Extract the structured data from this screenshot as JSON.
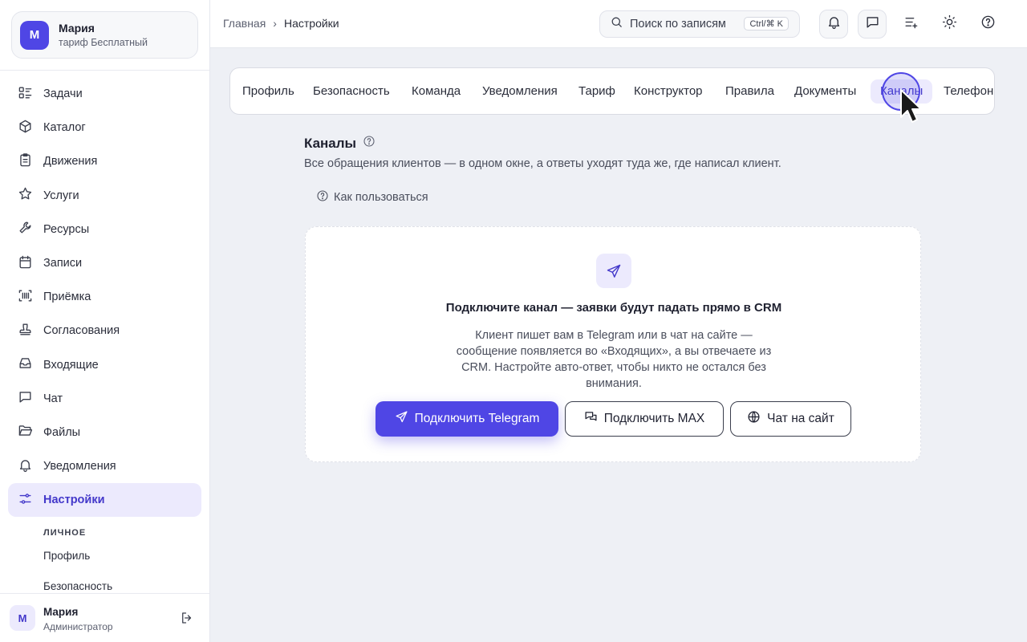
{
  "account": {
    "avatar_letter": "М",
    "name": "Мария",
    "plan": "тариф Бесплатный"
  },
  "sidebar": {
    "items": [
      {
        "label": "Задачи",
        "icon": "tasks-icon"
      },
      {
        "label": "Каталог",
        "icon": "box-icon"
      },
      {
        "label": "Движения",
        "icon": "clipboard-icon"
      },
      {
        "label": "Услуги",
        "icon": "star-icon"
      },
      {
        "label": "Ресурсы",
        "icon": "wrench-icon"
      },
      {
        "label": "Записи",
        "icon": "calendar-icon"
      },
      {
        "label": "Приёмка",
        "icon": "barcode-icon"
      },
      {
        "label": "Согласования",
        "icon": "stamp-icon"
      },
      {
        "label": "Входящие",
        "icon": "inbox-icon"
      },
      {
        "label": "Чат",
        "icon": "chat-icon"
      },
      {
        "label": "Файлы",
        "icon": "folder-icon"
      },
      {
        "label": "Уведомления",
        "icon": "bell-icon"
      },
      {
        "label": "Настройки",
        "icon": "sliders-icon",
        "active": true
      }
    ],
    "sub_heading": "ЛИЧНОЕ",
    "sub_items": [
      "Профиль",
      "Безопасность"
    ]
  },
  "footer": {
    "avatar_letter": "М",
    "name": "Мария",
    "role": "Администратор"
  },
  "topbar": {
    "breadcrumb_home": "Главная",
    "breadcrumb_sep": "›",
    "breadcrumb_current": "Настройки",
    "search_placeholder": "Поиск по записям",
    "search_shortcut": "Ctrl/⌘ K"
  },
  "tabs": [
    "Профиль",
    "Безопасность",
    "Команда",
    "Уведомления",
    "Тариф",
    "Конструктор",
    "Правила",
    "Документы",
    "Каналы",
    "Телефония"
  ],
  "active_tab": "Каналы",
  "page": {
    "title": "Каналы",
    "description": "Все обращения клиентов — в одном окне, а ответы уходят туда же, где написал клиент.",
    "howto": "Как пользоваться"
  },
  "empty_state": {
    "title": "Подключите канал — заявки будут падать прямо в CRM",
    "text": "Клиент пишет вам в Telegram или в чат на сайте — сообщение появляется во «Входящих», а вы отвечаете из CRM. Настройте авто-ответ, чтобы никто не остался без внимания.",
    "buttons": {
      "telegram": "Подключить Telegram",
      "max": "Подключить MAX",
      "site_chat": "Чат на сайт"
    }
  },
  "colors": {
    "accent": "#4f46e5",
    "accent_soft": "#eceafd",
    "background": "#eef0f5"
  }
}
